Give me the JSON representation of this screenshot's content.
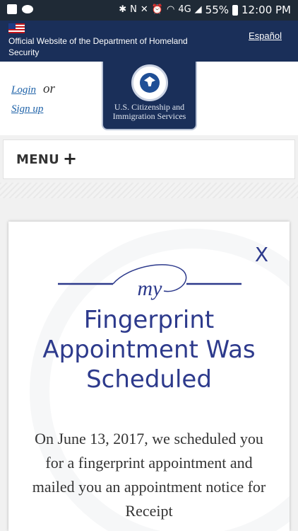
{
  "status_bar": {
    "left_icons": [
      "facebook-icon",
      "cloud-icon"
    ],
    "right_icons": [
      "bluetooth-icon",
      "nfc-icon",
      "mute-icon",
      "alarm-icon",
      "wifi-icon",
      "signal-icon"
    ],
    "network": "4G",
    "battery": "55%",
    "time": "12:00 PM"
  },
  "dhs_banner": {
    "text": "Official Website of the Department of Homeland Security",
    "language_link": "Español"
  },
  "header": {
    "login": "Login",
    "or": "or",
    "signup": "Sign up",
    "agency_line1": "U.S. Citizenship and",
    "agency_line2": "Immigration Services"
  },
  "menu": {
    "label": "MENU",
    "icon": "+"
  },
  "modal": {
    "close": "X",
    "logo_text": "my",
    "title": "Fingerprint Appointment Was Scheduled",
    "body": "On June 13, 2017, we scheduled you for a fingerprint appointment and mailed you an appointment notice for Receipt"
  },
  "colors": {
    "navy": "#1a2f59",
    "accent_blue": "#2d3a8c",
    "link_blue": "#1e62a8"
  }
}
